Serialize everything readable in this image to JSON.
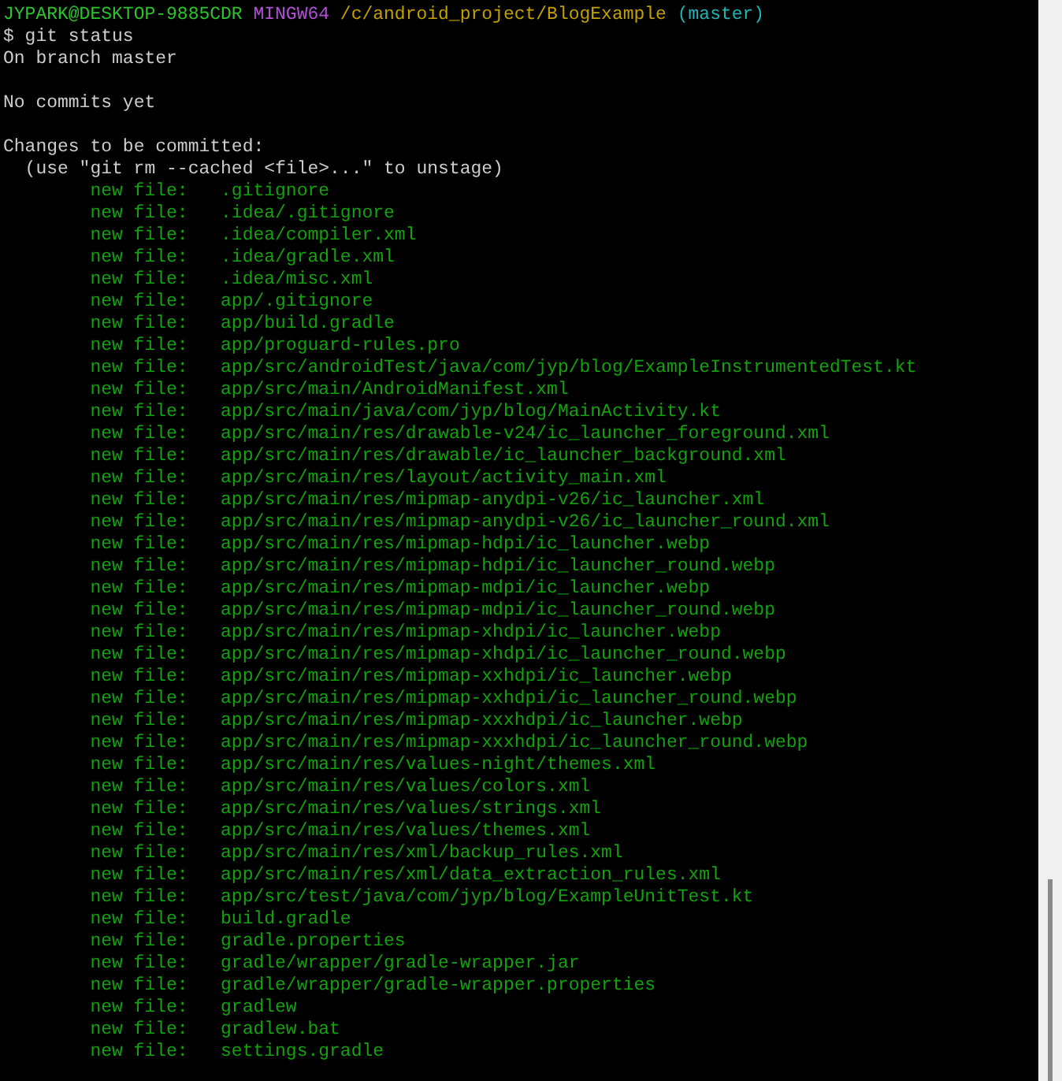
{
  "prompt": {
    "user_host": "JYPARK@DESKTOP-9885CDR",
    "system": "MINGW64",
    "path": "/c/android_project/BlogExample",
    "branch": "(master)"
  },
  "command": "$ git status",
  "output": [
    {
      "kind": "text",
      "text": "On branch master"
    },
    {
      "kind": "blank"
    },
    {
      "kind": "text",
      "text": "No commits yet"
    },
    {
      "kind": "blank"
    },
    {
      "kind": "text",
      "text": "Changes to be committed:"
    },
    {
      "kind": "hint",
      "text": "(use \"git rm --cached <file>...\" to unstage)"
    }
  ],
  "files": [
    {
      "status": "new file:",
      "path": ".gitignore"
    },
    {
      "status": "new file:",
      "path": ".idea/.gitignore"
    },
    {
      "status": "new file:",
      "path": ".idea/compiler.xml"
    },
    {
      "status": "new file:",
      "path": ".idea/gradle.xml"
    },
    {
      "status": "new file:",
      "path": ".idea/misc.xml"
    },
    {
      "status": "new file:",
      "path": "app/.gitignore"
    },
    {
      "status": "new file:",
      "path": "app/build.gradle"
    },
    {
      "status": "new file:",
      "path": "app/proguard-rules.pro"
    },
    {
      "status": "new file:",
      "path": "app/src/androidTest/java/com/jyp/blog/ExampleInstrumentedTest.kt"
    },
    {
      "status": "new file:",
      "path": "app/src/main/AndroidManifest.xml"
    },
    {
      "status": "new file:",
      "path": "app/src/main/java/com/jyp/blog/MainActivity.kt"
    },
    {
      "status": "new file:",
      "path": "app/src/main/res/drawable-v24/ic_launcher_foreground.xml"
    },
    {
      "status": "new file:",
      "path": "app/src/main/res/drawable/ic_launcher_background.xml"
    },
    {
      "status": "new file:",
      "path": "app/src/main/res/layout/activity_main.xml"
    },
    {
      "status": "new file:",
      "path": "app/src/main/res/mipmap-anydpi-v26/ic_launcher.xml"
    },
    {
      "status": "new file:",
      "path": "app/src/main/res/mipmap-anydpi-v26/ic_launcher_round.xml"
    },
    {
      "status": "new file:",
      "path": "app/src/main/res/mipmap-hdpi/ic_launcher.webp"
    },
    {
      "status": "new file:",
      "path": "app/src/main/res/mipmap-hdpi/ic_launcher_round.webp"
    },
    {
      "status": "new file:",
      "path": "app/src/main/res/mipmap-mdpi/ic_launcher.webp"
    },
    {
      "status": "new file:",
      "path": "app/src/main/res/mipmap-mdpi/ic_launcher_round.webp"
    },
    {
      "status": "new file:",
      "path": "app/src/main/res/mipmap-xhdpi/ic_launcher.webp"
    },
    {
      "status": "new file:",
      "path": "app/src/main/res/mipmap-xhdpi/ic_launcher_round.webp"
    },
    {
      "status": "new file:",
      "path": "app/src/main/res/mipmap-xxhdpi/ic_launcher.webp"
    },
    {
      "status": "new file:",
      "path": "app/src/main/res/mipmap-xxhdpi/ic_launcher_round.webp"
    },
    {
      "status": "new file:",
      "path": "app/src/main/res/mipmap-xxxhdpi/ic_launcher.webp"
    },
    {
      "status": "new file:",
      "path": "app/src/main/res/mipmap-xxxhdpi/ic_launcher_round.webp"
    },
    {
      "status": "new file:",
      "path": "app/src/main/res/values-night/themes.xml"
    },
    {
      "status": "new file:",
      "path": "app/src/main/res/values/colors.xml"
    },
    {
      "status": "new file:",
      "path": "app/src/main/res/values/strings.xml"
    },
    {
      "status": "new file:",
      "path": "app/src/main/res/values/themes.xml"
    },
    {
      "status": "new file:",
      "path": "app/src/main/res/xml/backup_rules.xml"
    },
    {
      "status": "new file:",
      "path": "app/src/main/res/xml/data_extraction_rules.xml"
    },
    {
      "status": "new file:",
      "path": "app/src/test/java/com/jyp/blog/ExampleUnitTest.kt"
    },
    {
      "status": "new file:",
      "path": "build.gradle"
    },
    {
      "status": "new file:",
      "path": "gradle.properties"
    },
    {
      "status": "new file:",
      "path": "gradle/wrapper/gradle-wrapper.jar"
    },
    {
      "status": "new file:",
      "path": "gradle/wrapper/gradle-wrapper.properties"
    },
    {
      "status": "new file:",
      "path": "gradlew"
    },
    {
      "status": "new file:",
      "path": "gradlew.bat"
    },
    {
      "status": "new file:",
      "path": "settings.gradle"
    }
  ]
}
